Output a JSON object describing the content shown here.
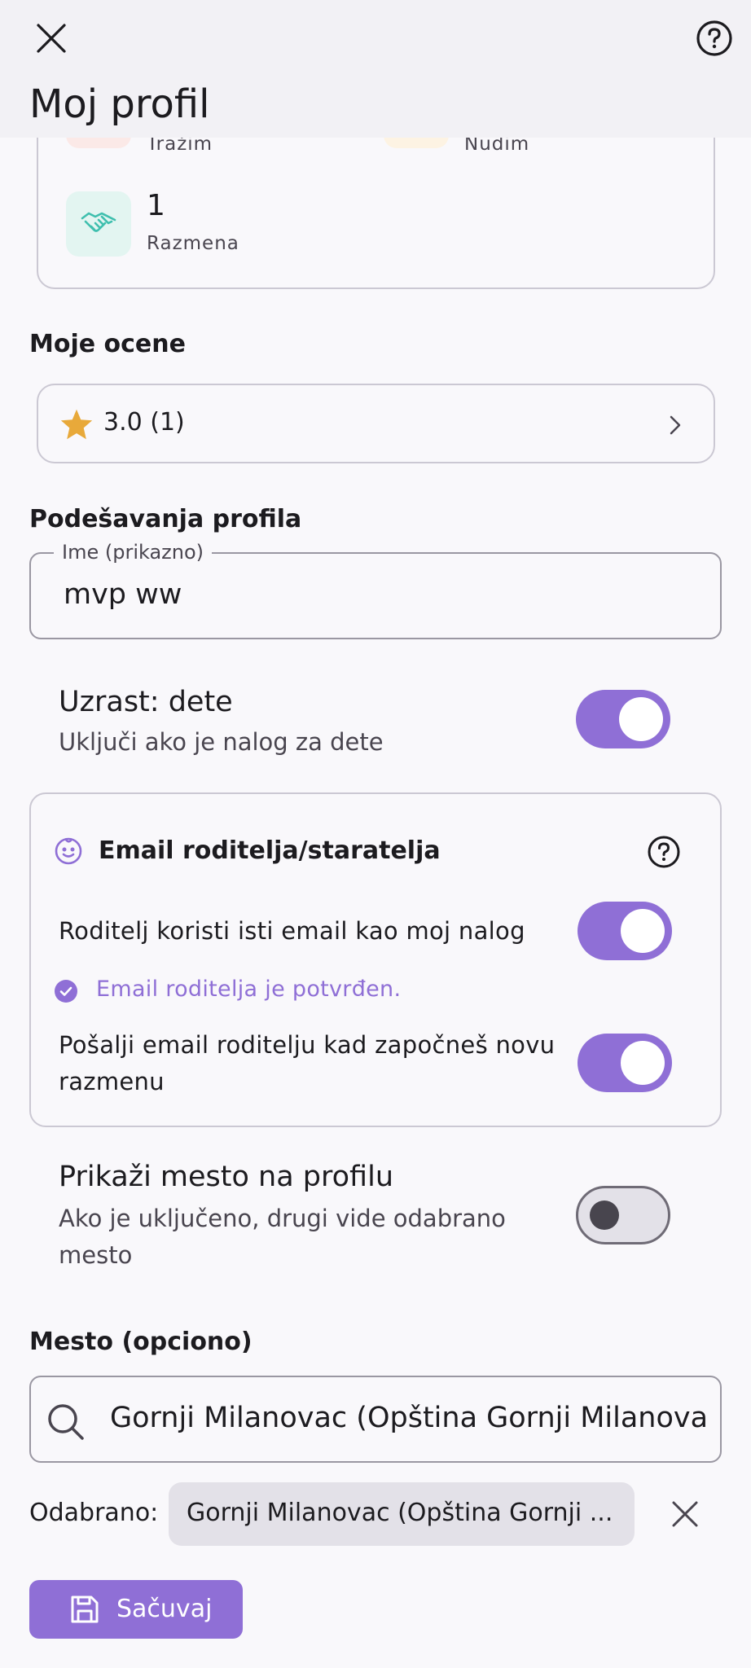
{
  "header": {
    "title": "Moj profil",
    "close_icon": "close-icon",
    "help_icon": "help-circle-icon"
  },
  "stats": {
    "trazim_label": "Tražim",
    "nudim_label": "Nudim",
    "razmena_value": "1",
    "razmena_label": "Razmena"
  },
  "ratings": {
    "section_title": "Moje ocene",
    "value": "3.0 (1)"
  },
  "profile_settings": {
    "section_title": "Podešavanja profila",
    "name_label": "Ime (prikazno)",
    "name_value": "mvp ww",
    "age_title": "Uzrast: dete",
    "age_sub": "Uključi ako je nalog za dete",
    "age_enabled": true
  },
  "parent_email": {
    "title": "Email roditelja/staratelja",
    "same_email_label": "Roditelj koristi isti email kao moj nalog",
    "same_email_enabled": true,
    "verified_text": "Email roditelja je potvrđen.",
    "notify_label_line1": "Pošalji email roditelju kad započneš novu",
    "notify_label_line2": "razmenu",
    "notify_enabled": true
  },
  "location_visibility": {
    "title": "Prikaži mesto na profilu",
    "sub_line1": "Ako je uključeno, drugi vide odabrano",
    "sub_line2": "mesto",
    "enabled": false
  },
  "location": {
    "section_title": "Mesto (opciono)",
    "search_value": "Gornji Milanovac (Opština Gornji Milanova",
    "selected_label": "Odabrano:",
    "selected_value": "Gornji Milanovac (Opština Gornji ..."
  },
  "save": {
    "label": "Sačuvaj"
  },
  "colors": {
    "accent": "#8f6fd6",
    "star": "#e8a93a",
    "handshake": "#3fbfae"
  }
}
